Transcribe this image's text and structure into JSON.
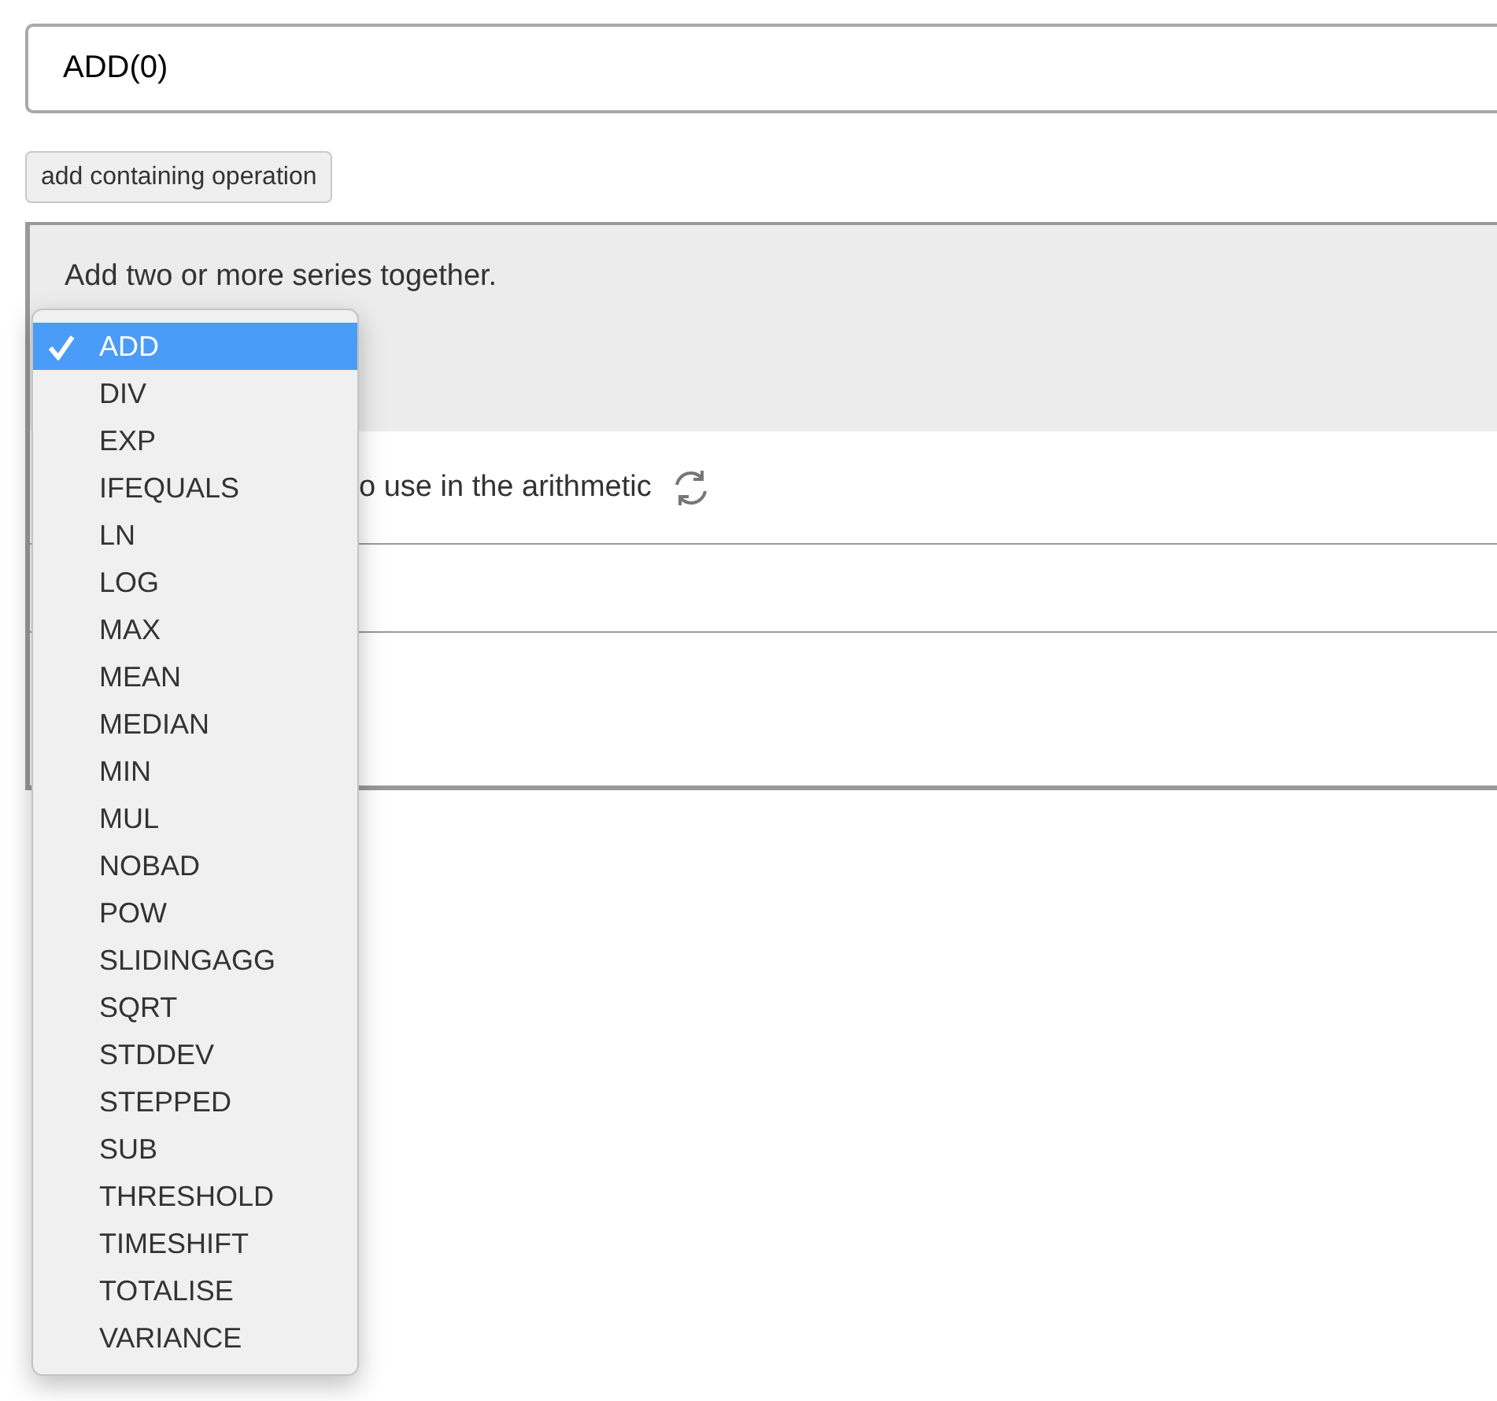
{
  "expression_field": {
    "value": "ADD(0)"
  },
  "add_button": {
    "label": "add containing operation"
  },
  "panel": {
    "description": "Add two or more series together.",
    "series_row": {
      "label": "o use in the arithmetic"
    }
  },
  "operation_menu": {
    "items": [
      {
        "label": "ADD",
        "selected": true
      },
      {
        "label": "DIV",
        "selected": false
      },
      {
        "label": "EXP",
        "selected": false
      },
      {
        "label": "IFEQUALS",
        "selected": false
      },
      {
        "label": "LN",
        "selected": false
      },
      {
        "label": "LOG",
        "selected": false
      },
      {
        "label": "MAX",
        "selected": false
      },
      {
        "label": "MEAN",
        "selected": false
      },
      {
        "label": "MEDIAN",
        "selected": false
      },
      {
        "label": "MIN",
        "selected": false
      },
      {
        "label": "MUL",
        "selected": false
      },
      {
        "label": "NOBAD",
        "selected": false
      },
      {
        "label": "POW",
        "selected": false
      },
      {
        "label": "SLIDINGAGG",
        "selected": false
      },
      {
        "label": "SQRT",
        "selected": false
      },
      {
        "label": "STDDEV",
        "selected": false
      },
      {
        "label": "STEPPED",
        "selected": false
      },
      {
        "label": "SUB",
        "selected": false
      },
      {
        "label": "THRESHOLD",
        "selected": false
      },
      {
        "label": "TIMESHIFT",
        "selected": false
      },
      {
        "label": "TOTALISE",
        "selected": false
      },
      {
        "label": "VARIANCE",
        "selected": false
      }
    ]
  }
}
